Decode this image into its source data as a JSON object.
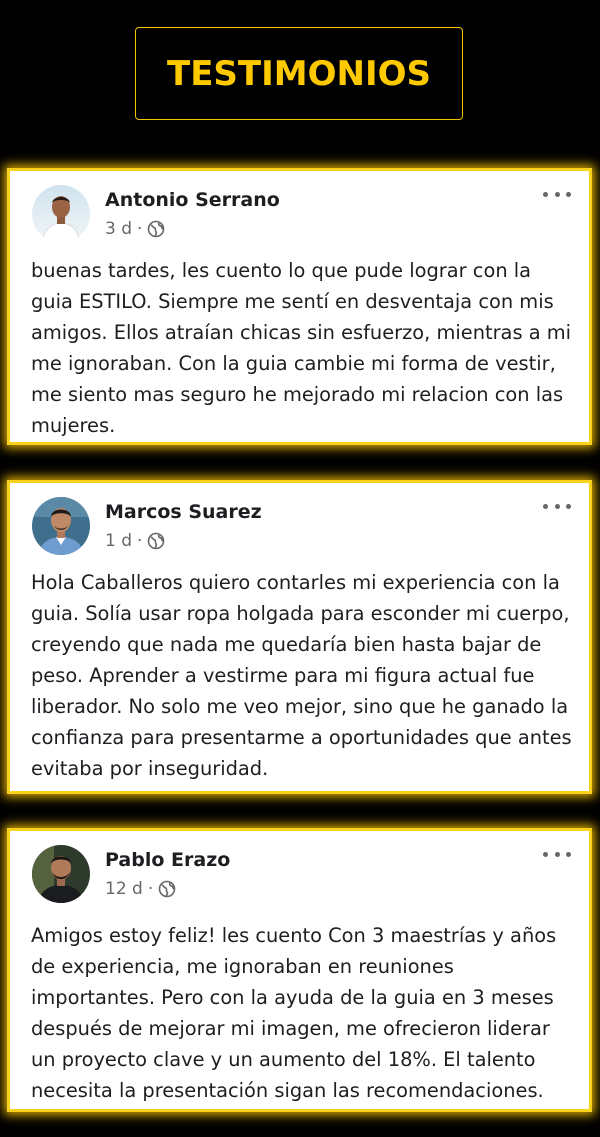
{
  "header": {
    "title": "TESTIMONIOS"
  },
  "colors": {
    "background": "#000000",
    "accent": "#ffc900",
    "card_border": "#f7d11a",
    "text": "#1c1e21",
    "muted": "#65676b"
  },
  "posts": [
    {
      "author": "Antonio Serrano",
      "time": "3 d",
      "separator": "·",
      "privacy_icon": "globe-icon",
      "menu_icon": "more-options-icon",
      "text": "buenas tardes, les cuento lo que pude lograr con la guia ESTILO. Siempre me sentí en desventaja con mis amigos. Ellos atraían chicas sin esfuerzo, mientras a mi me ignoraban. Con la guia cambie mi forma de vestir, me siento mas seguro he mejorado mi relacion con las mujeres."
    },
    {
      "author": "Marcos Suarez",
      "time": "1 d",
      "separator": "·",
      "privacy_icon": "globe-icon",
      "menu_icon": "more-options-icon",
      "text": "Hola Caballeros quiero contarles mi experiencia con la guia. Solía usar ropa holgada para esconder mi cuerpo, creyendo que nada me quedaría bien hasta bajar de peso. Aprender a vestirme para mi figura actual fue liberador. No solo me veo mejor, sino que he ganado la confianza para presentarme a oportunidades que antes evitaba por inseguridad."
    },
    {
      "author": "Pablo Erazo",
      "time": "12 d",
      "separator": "·",
      "privacy_icon": "globe-icon",
      "menu_icon": "more-options-icon",
      "text": "Amigos estoy feliz! les cuento Con 3 maestrías y años de experiencia, me ignoraban en reuniones importantes. Pero con la ayuda de la guia en 3 meses después de mejorar mi imagen, me ofrecieron liderar un proyecto clave y un aumento del 18%. El talento necesita la presentación sigan las recomendaciones."
    }
  ]
}
